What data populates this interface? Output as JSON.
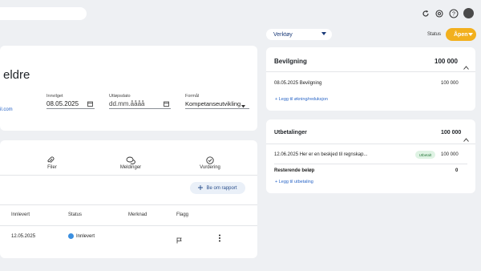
{
  "topbar": {
    "search_placeholder": "",
    "icons": [
      "refresh-icon",
      "gear-icon",
      "help-icon"
    ]
  },
  "header": {
    "tool_select": "Verktøy",
    "status_label": "Status",
    "status_value": "Åpen"
  },
  "main": {
    "title": "eldre",
    "email_fragment": "il.com",
    "fields": [
      {
        "label": "Innvilget",
        "value": "08.05.2025"
      },
      {
        "label": "Utløpsdato",
        "value": "dd.mm.åååå"
      },
      {
        "label": "Formål",
        "value": "Kompetanseutvikling"
      }
    ]
  },
  "tabs": [
    {
      "label": "Filer"
    },
    {
      "label": "Meldinger"
    },
    {
      "label": "Vurdering"
    }
  ],
  "report_button": "Be om rapport",
  "table": {
    "headers": [
      "Innlevert",
      "Status",
      "Merknad",
      "Flagg"
    ],
    "rows": [
      {
        "innlevert": "12.05.2025",
        "status": "Innlevert",
        "merknad": ""
      }
    ]
  },
  "bevilgning": {
    "title": "Bevilgning",
    "total": "100 000",
    "row_date_text": "08.05.2025  Bevilgning",
    "row_amount": "100 000",
    "add_link": "+ Legg til økning/reduksjon"
  },
  "utbetalinger": {
    "title": "Utbetalinger",
    "total": "100 000",
    "row_text": "12.06.2025  Her er en beskjed til regnskap...",
    "badge": "Utbetalt",
    "row_amount": "100 000",
    "remaining_label": "Resterende beløp",
    "remaining_value": "0",
    "add_link": "+ Legg til utbetaling"
  },
  "colors": {
    "accent": "#f2b01e",
    "link": "#2a66c7",
    "background": "#eef0f3"
  }
}
